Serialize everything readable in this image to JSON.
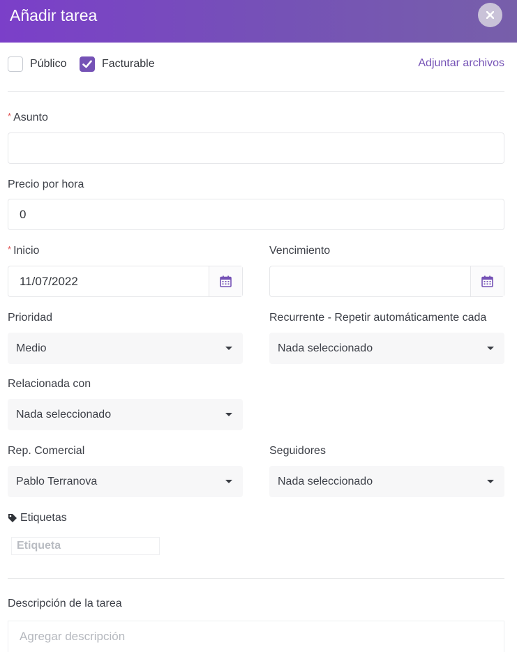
{
  "header": {
    "title": "Añadir tarea",
    "close_icon": "close-icon"
  },
  "options": {
    "public_label": "Público",
    "public_checked": false,
    "billable_label": "Facturable",
    "billable_checked": true,
    "attach_label": "Adjuntar archivos"
  },
  "form": {
    "subject": {
      "label": "Asunto",
      "required": true,
      "value": ""
    },
    "hourly_rate": {
      "label": "Precio por hora",
      "value": "0"
    },
    "start": {
      "label": "Inicio",
      "required": true,
      "value": "11/07/2022",
      "icon": "calendar-icon"
    },
    "due": {
      "label": "Vencimiento",
      "value": "",
      "icon": "calendar-icon"
    },
    "priority": {
      "label": "Prioridad",
      "value": "Medio"
    },
    "recurring": {
      "label": "Recurrente - Repetir automáticamente cada",
      "value": "Nada seleccionado"
    },
    "related": {
      "label": "Relacionada con",
      "value": "Nada seleccionado"
    },
    "sales_rep": {
      "label": "Rep. Comercial",
      "value": "Pablo Terranova"
    },
    "followers": {
      "label": "Seguidores",
      "value": "Nada seleccionado"
    },
    "tags": {
      "label": "Etiquetas",
      "placeholder": "Etiqueta",
      "icon": "tag-icon"
    },
    "description": {
      "label": "Descripción de la tarea",
      "placeholder": "Agregar descripción"
    }
  },
  "colors": {
    "accent": "#7552b6",
    "required": "#e05353"
  }
}
